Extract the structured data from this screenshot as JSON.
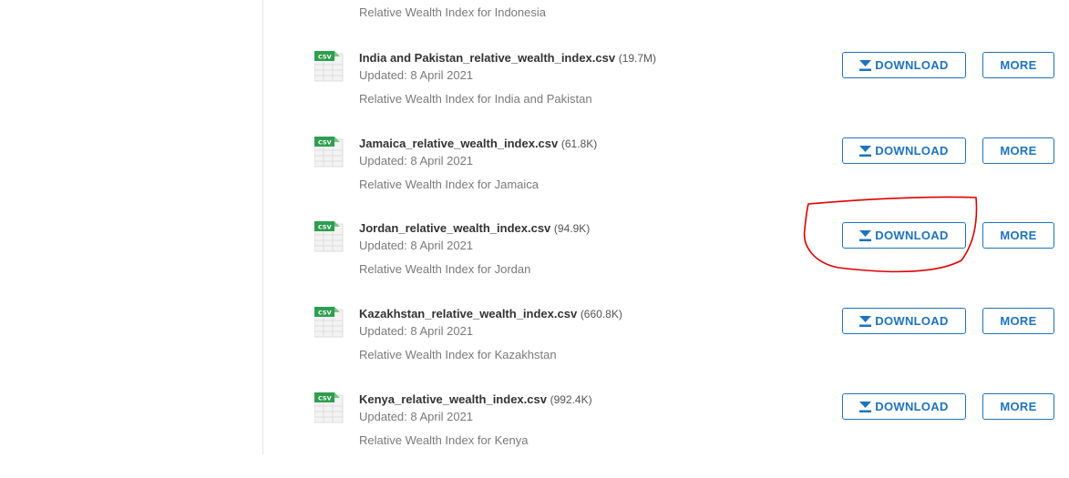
{
  "top_description": "Relative Wealth Index for Indonesia",
  "icon_label": "CSV",
  "colors": {
    "accent": "#1e73be",
    "csv_green": "#2e9e4f",
    "annotation": "#e00000"
  },
  "resources": [
    {
      "filename": "India and Pakistan_relative_wealth_index.csv",
      "size": "(19.7M)",
      "updated": "Updated: 8 April 2021",
      "description": "Relative Wealth Index for India and Pakistan",
      "download_label": "DOWNLOAD",
      "more_label": "MORE"
    },
    {
      "filename": "Jamaica_relative_wealth_index.csv",
      "size": "(61.8K)",
      "updated": "Updated: 8 April 2021",
      "description": "Relative Wealth Index for Jamaica",
      "download_label": "DOWNLOAD",
      "more_label": "MORE"
    },
    {
      "filename": "Jordan_relative_wealth_index.csv",
      "size": "(94.9K)",
      "updated": "Updated: 8 April 2021",
      "description": "Relative Wealth Index for Jordan",
      "download_label": "DOWNLOAD",
      "more_label": "MORE"
    },
    {
      "filename": "Kazakhstan_relative_wealth_index.csv",
      "size": "(660.8K)",
      "updated": "Updated: 8 April 2021",
      "description": "Relative Wealth Index for Kazakhstan",
      "download_label": "DOWNLOAD",
      "more_label": "MORE"
    },
    {
      "filename": "Kenya_relative_wealth_index.csv",
      "size": "(992.4K)",
      "updated": "Updated: 8 April 2021",
      "description": "Relative Wealth Index for Kenya",
      "download_label": "DOWNLOAD",
      "more_label": "MORE"
    }
  ]
}
